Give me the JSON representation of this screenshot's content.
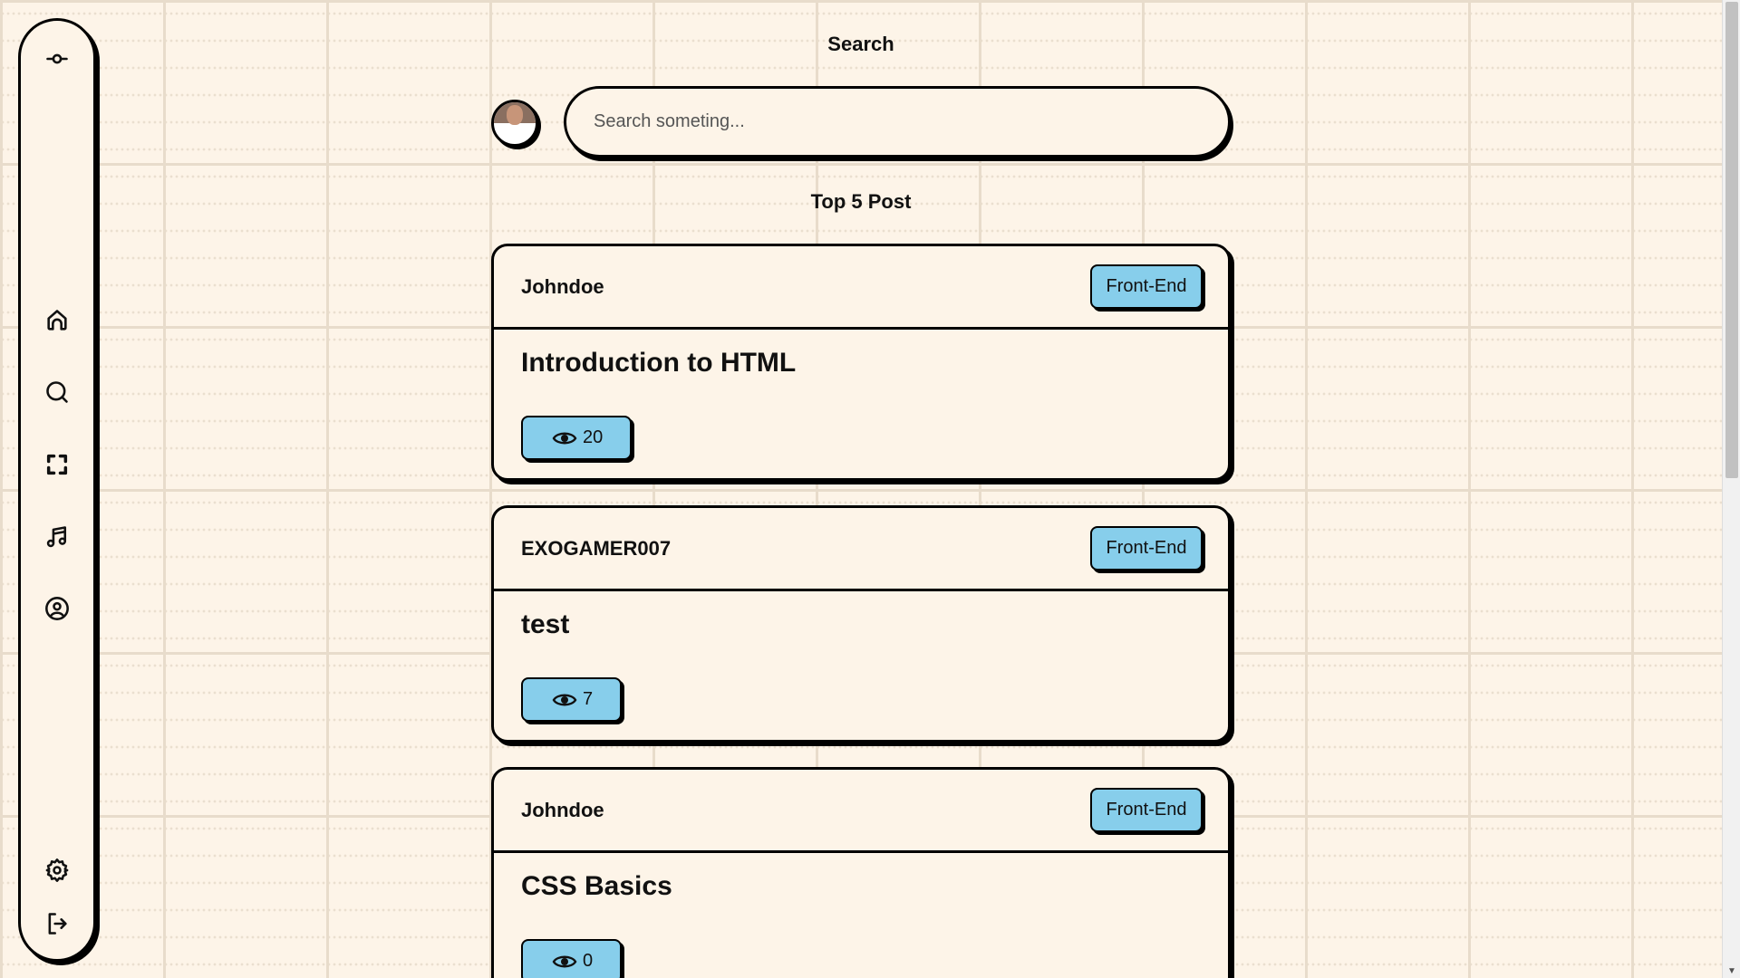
{
  "header": {
    "title": "Search"
  },
  "search": {
    "placeholder": "Search someting...",
    "value": ""
  },
  "section_title": "Top 5 Post",
  "sidebar": {
    "items": [
      {
        "icon": "commit-icon"
      },
      {
        "icon": "home-icon"
      },
      {
        "icon": "search-icon"
      },
      {
        "icon": "fullscreen-icon"
      },
      {
        "icon": "music-icon"
      },
      {
        "icon": "user-circle-icon"
      },
      {
        "icon": "gear-icon"
      },
      {
        "icon": "logout-icon"
      }
    ]
  },
  "posts": [
    {
      "author": "Johndoe",
      "tag": "Front-End",
      "title": "Introduction to HTML",
      "views": "20"
    },
    {
      "author": "EXOGAMER007",
      "tag": "Front-End",
      "title": "test",
      "views": "7"
    },
    {
      "author": "Johndoe",
      "tag": "Front-End",
      "title": "CSS Basics",
      "views": "0"
    }
  ],
  "colors": {
    "background": "#fdf4e8",
    "accent": "#87ceeb",
    "border": "#000000"
  }
}
